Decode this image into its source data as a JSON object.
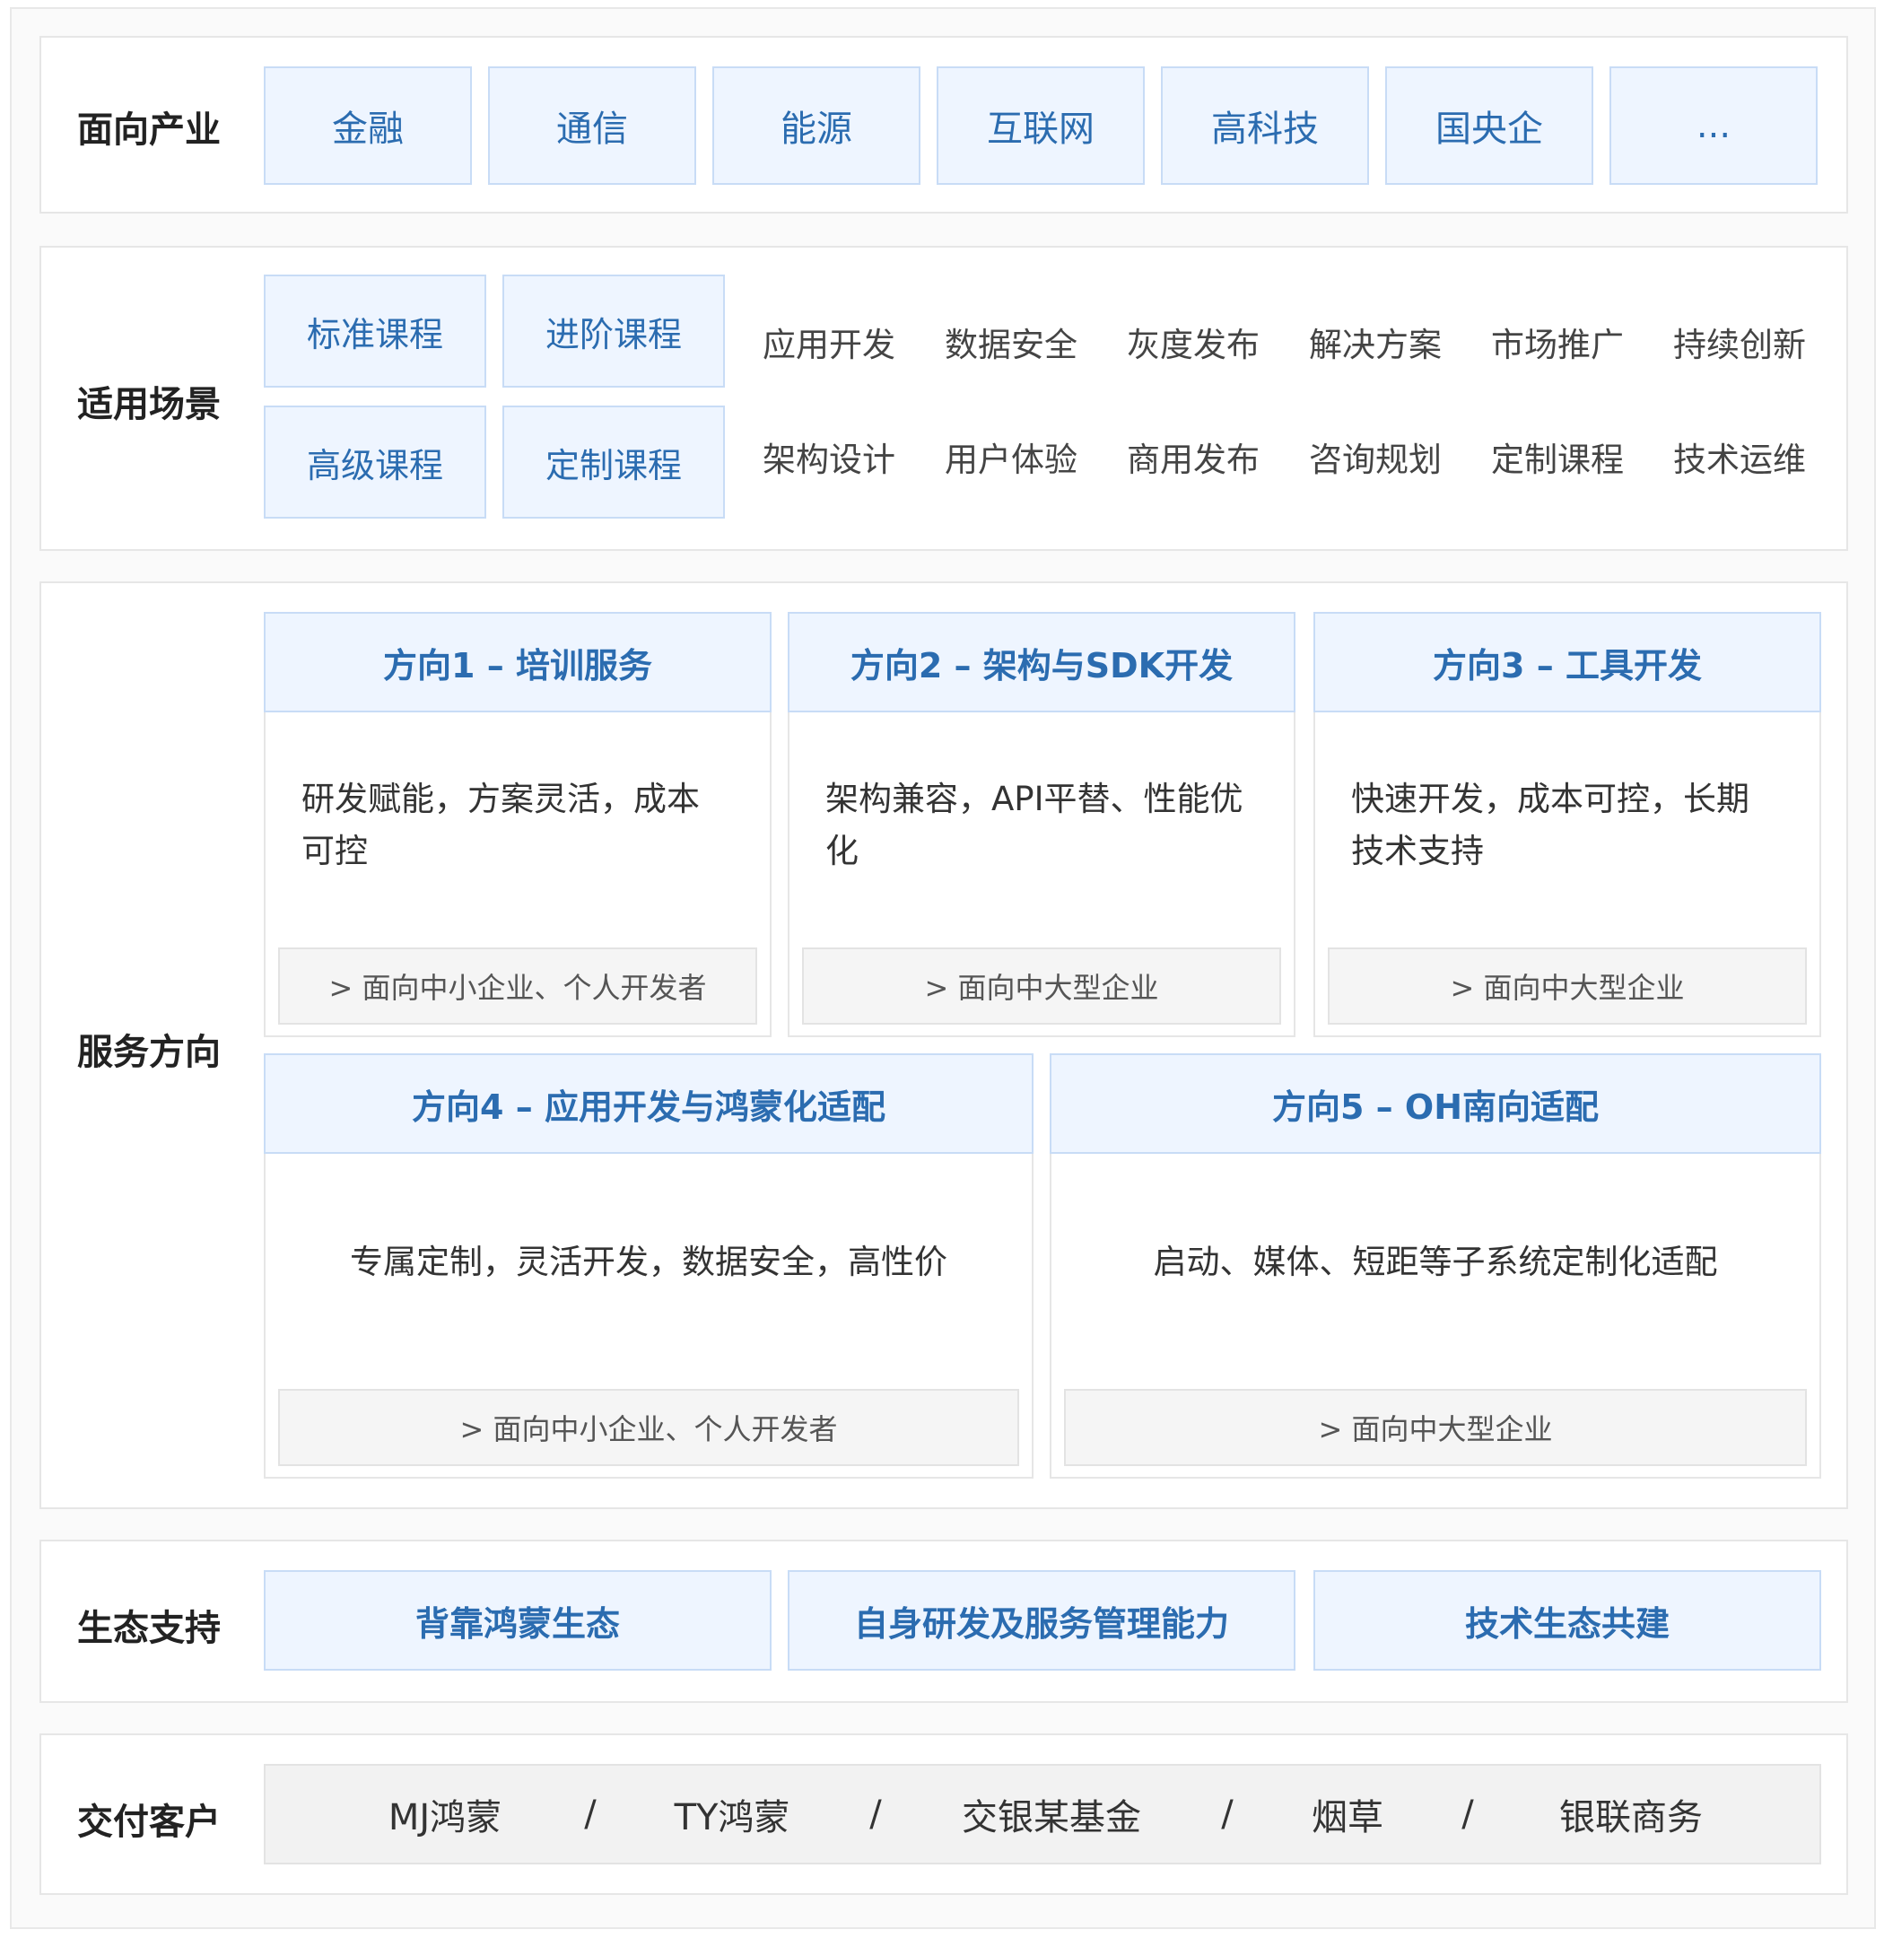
{
  "industries": {
    "label": "面向产业",
    "items": [
      "金融",
      "通信",
      "能源",
      "互联网",
      "高科技",
      "国央企",
      "..."
    ]
  },
  "scenarios": {
    "label": "适用场景",
    "courses": [
      "标准课程",
      "进阶课程",
      "高级课程",
      "定制课程"
    ],
    "row1": [
      "应用开发",
      "数据安全",
      "灰度发布",
      "解决方案",
      "市场推广",
      "持续创新"
    ],
    "row2": [
      "架构设计",
      "用户体验",
      "商用发布",
      "咨询规划",
      "定制课程",
      "技术运维"
    ]
  },
  "services": {
    "label": "服务方向",
    "cards": [
      {
        "title": "方向1 – 培训服务",
        "desc": "研发赋能，方案灵活，成本可控",
        "audience": "> 面向中小企业、个人开发者"
      },
      {
        "title": "方向2 – 架构与SDK开发",
        "desc": "架构兼容，API平替、性能优化",
        "audience": "> 面向中大型企业"
      },
      {
        "title": "方向3 – 工具开发",
        "desc": "快速开发，成本可控，长期技术支持",
        "audience": "> 面向中大型企业"
      },
      {
        "title": "方向4 – 应用开发与鸿蒙化适配",
        "desc": "专属定制，灵活开发，数据安全，高性价",
        "audience": "> 面向中小企业、个人开发者"
      },
      {
        "title": "方向5 – OH南向适配",
        "desc": "启动、媒体、短距等子系统定制化适配",
        "audience": "> 面向中大型企业"
      }
    ]
  },
  "ecosystem": {
    "label": "生态支持",
    "items": [
      "背靠鸿蒙生态",
      "自身研发及服务管理能力",
      "技术生态共建"
    ]
  },
  "clients": {
    "label": "交付客户",
    "items": [
      "MJ鸿蒙",
      "TY鸿蒙",
      "交银某基金",
      "烟草",
      "银联商务"
    ],
    "separator": "/"
  }
}
